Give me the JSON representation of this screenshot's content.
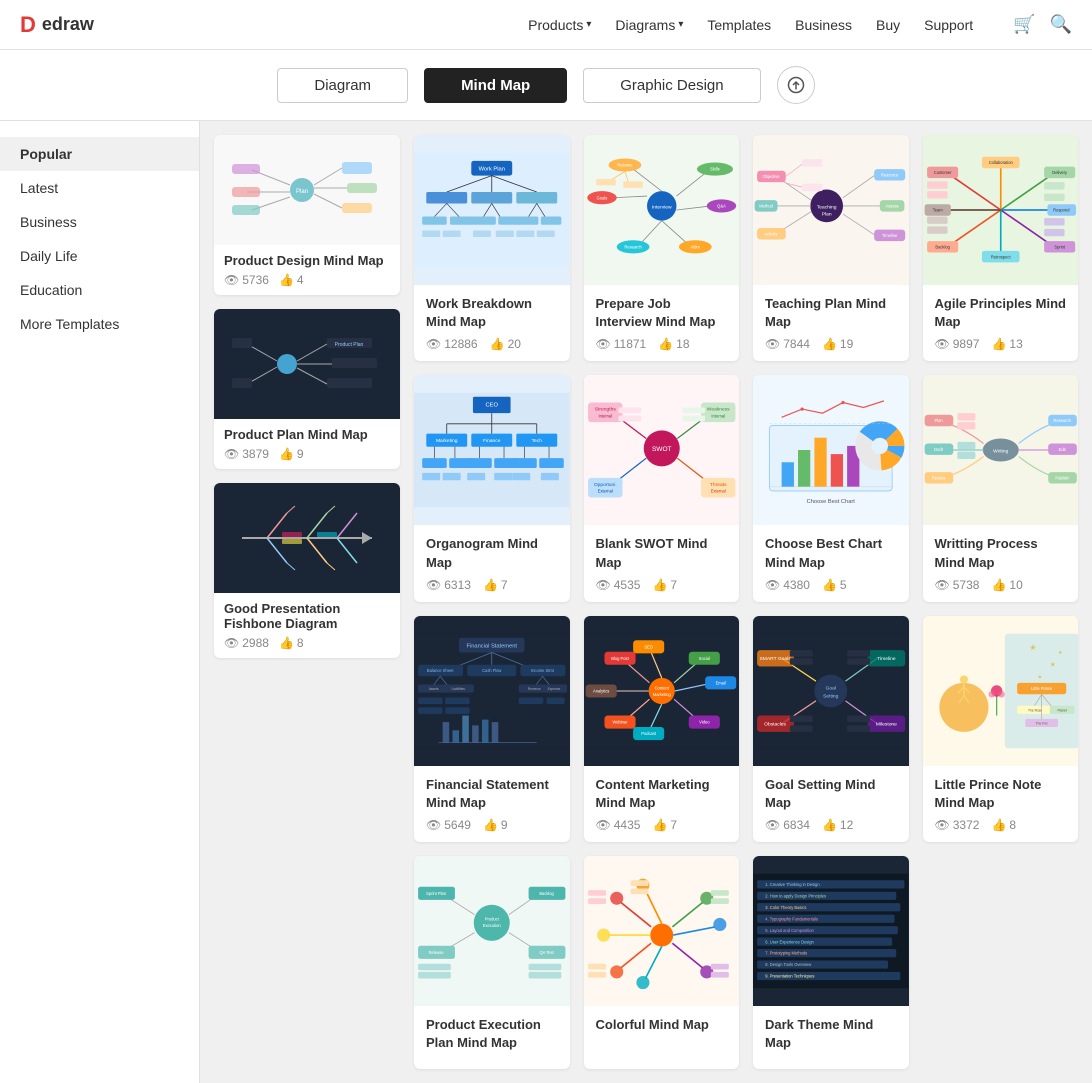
{
  "logo": {
    "icon": "D",
    "name": "edraw"
  },
  "navbar": {
    "items": [
      {
        "label": "Products",
        "hasDropdown": true
      },
      {
        "label": "Diagrams",
        "hasDropdown": true
      },
      {
        "label": "Templates",
        "hasDropdown": false
      },
      {
        "label": "Business",
        "hasDropdown": false
      },
      {
        "label": "Buy",
        "hasDropdown": false
      },
      {
        "label": "Support",
        "hasDropdown": false
      }
    ]
  },
  "tabs": [
    {
      "label": "Diagram",
      "active": false
    },
    {
      "label": "Mind Map",
      "active": true
    },
    {
      "label": "Graphic Design",
      "active": false
    }
  ],
  "upload_button_label": "⬆",
  "sidebar": {
    "items": [
      {
        "label": "Popular",
        "active": true
      },
      {
        "label": "Latest",
        "active": false
      },
      {
        "label": "Business",
        "active": false
      },
      {
        "label": "Daily Life",
        "active": false
      },
      {
        "label": "Education",
        "active": false
      },
      {
        "label": "More Templates",
        "active": false
      }
    ]
  },
  "sidebar_cards": [
    {
      "id": "product-design",
      "title": "Product Design Mind Map",
      "views": "5736",
      "likes": "4",
      "bg": "light",
      "color": "#b0d4f0"
    },
    {
      "id": "product-plan",
      "title": "Product Plan Mind Map",
      "views": "3879",
      "likes": "9",
      "bg": "dark",
      "color": "#1a2535"
    },
    {
      "id": "good-presentation",
      "title": "Good Presentation Fishbone Diagram",
      "views": "2988",
      "likes": "8",
      "bg": "dark",
      "color": "#1a2535"
    }
  ],
  "cards": [
    {
      "id": "work-breakdown",
      "title": "Work Breakdown Mind Map",
      "views": "12886",
      "likes": "20",
      "bg": "blue",
      "color": "#c8dff5"
    },
    {
      "id": "prepare-job",
      "title": "Prepare Job Interview Mind Map",
      "views": "11871",
      "likes": "18",
      "bg": "light",
      "color": "#f0f8f0"
    },
    {
      "id": "teaching-plan",
      "title": "Teaching Plan Mind Map",
      "views": "7844",
      "likes": "19",
      "bg": "light",
      "color": "#f5f0e8"
    },
    {
      "id": "agile-principles",
      "title": "Agile Principles Mind Map",
      "views": "9897",
      "likes": "13",
      "bg": "light",
      "color": "#e8f5e0"
    },
    {
      "id": "organogram",
      "title": "Organogram Mind Map",
      "views": "6313",
      "likes": "7",
      "bg": "blue",
      "color": "#ddeeff"
    },
    {
      "id": "blank-swot",
      "title": "Blank SWOT Mind Map",
      "views": "4535",
      "likes": "7",
      "bg": "light",
      "color": "#fff0f5"
    },
    {
      "id": "choose-best-chart",
      "title": "Choose Best Chart Mind Map",
      "views": "4380",
      "likes": "5",
      "bg": "light",
      "color": "#f0f8ff"
    },
    {
      "id": "writing-process",
      "title": "Writting Process Mind Map",
      "views": "5738",
      "likes": "10",
      "bg": "light",
      "color": "#f5f5e8"
    },
    {
      "id": "financial-statement",
      "title": "Financial Statement Mind Map",
      "views": "5649",
      "likes": "9",
      "bg": "dark",
      "color": "#1a2535"
    },
    {
      "id": "content-marketing",
      "title": "Content Marketing Mind Map",
      "views": "4435",
      "likes": "7",
      "bg": "dark",
      "color": "#1a2535"
    },
    {
      "id": "goal-setting",
      "title": "Goal Setting Mind Map",
      "views": "6834",
      "likes": "12",
      "bg": "dark",
      "color": "#1a2535"
    },
    {
      "id": "little-prince",
      "title": "Little Prince Note Mind Map",
      "views": "3372",
      "likes": "8",
      "bg": "light",
      "color": "#fef9e8"
    },
    {
      "id": "bottom1",
      "title": "Product Execution Plan Mind Map",
      "views": "",
      "likes": "",
      "bg": "light",
      "color": "#f0f8f5"
    },
    {
      "id": "bottom2",
      "title": "Colorful Mind Map",
      "views": "",
      "likes": "",
      "bg": "light",
      "color": "#fff8f0"
    },
    {
      "id": "bottom3",
      "title": "Dark Theme Mind Map",
      "views": "",
      "likes": "",
      "bg": "dark",
      "color": "#1a2535"
    }
  ],
  "icons": {
    "view": "👁",
    "like": "👍",
    "cart": "🛒",
    "search": "🔍",
    "upload": "⬆"
  }
}
